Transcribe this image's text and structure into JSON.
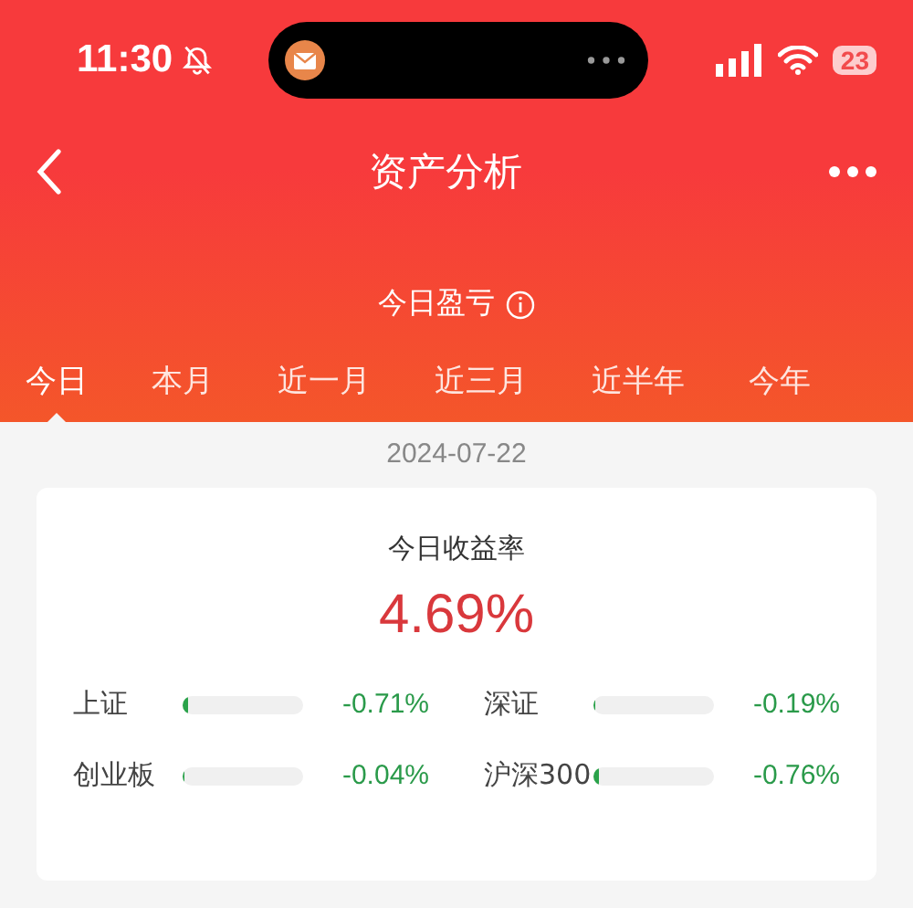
{
  "status_bar": {
    "time": "11:30",
    "battery": "23"
  },
  "nav": {
    "title": "资产分析"
  },
  "summary": {
    "label": "今日盈亏"
  },
  "tabs": [
    {
      "label": "今日",
      "selected": true
    },
    {
      "label": "本月",
      "selected": false
    },
    {
      "label": "近一月",
      "selected": false
    },
    {
      "label": "近三月",
      "selected": false
    },
    {
      "label": "近半年",
      "selected": false
    },
    {
      "label": "今年",
      "selected": false
    }
  ],
  "date": "2024-07-22",
  "card": {
    "label": "今日收益率",
    "value": "4.69%",
    "indices": [
      {
        "name": "上证",
        "level": 0.05,
        "reading": "-0.71%"
      },
      {
        "name": "深证",
        "level": 0.02,
        "reading": "-0.19%"
      },
      {
        "name": "创业板",
        "level": 0.01,
        "reading": "-0.04%"
      },
      {
        "name": "沪深300",
        "level": 0.05,
        "reading": "-0.76%"
      }
    ]
  }
}
